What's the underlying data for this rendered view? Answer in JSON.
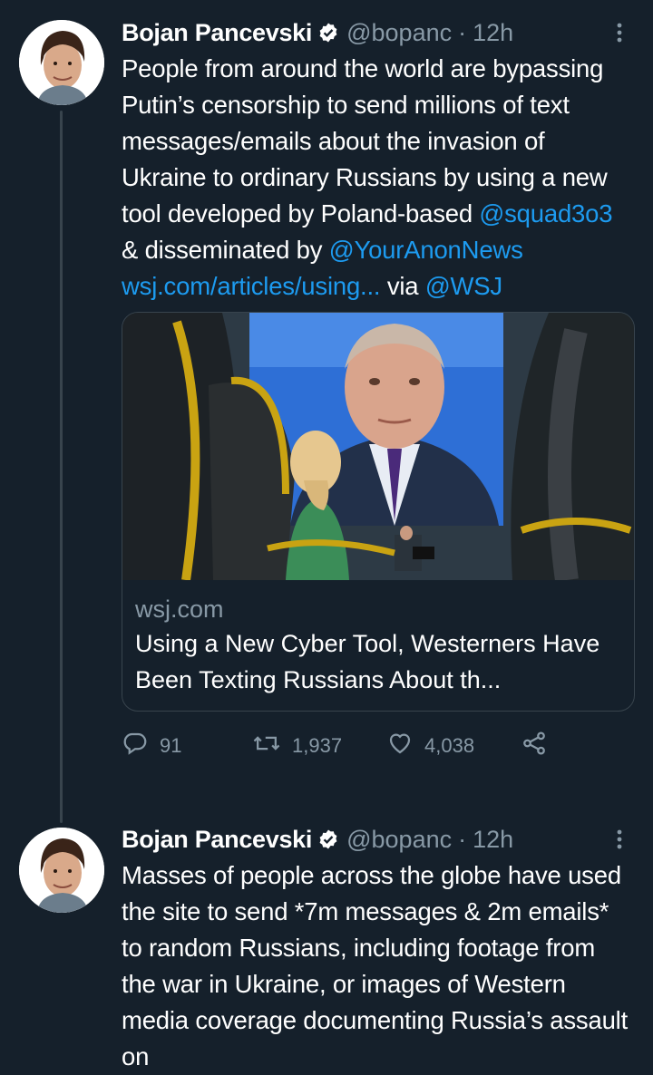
{
  "tweets": [
    {
      "author_name": "Bojan Pancevski",
      "handle": "@bopanc",
      "separator": "·",
      "time": "12h",
      "text_parts": {
        "p1": "People from around the world are bypassing Putin’s censorship to send millions of text messages/emails about the invasion of Ukraine to ordinary Russians by using a new tool developed by Poland-based ",
        "mention1": "@squad3o3",
        "p2": " & disseminated by ",
        "mention2": "@YourAnonNews",
        "link": "wsj.com/articles/using...",
        "p3": " via ",
        "mention3": "@WSJ"
      },
      "card": {
        "domain": "wsj.com",
        "title": "Using a New Cyber Tool, Westerners Have Been Texting Russians About th..."
      },
      "actions": {
        "replies": "91",
        "retweets": "1,937",
        "likes": "4,038"
      }
    },
    {
      "author_name": "Bojan Pancevski",
      "handle": "@bopanc",
      "separator": "·",
      "time": "12h",
      "text": "Masses of people across the globe have used the site to send *7m messages & 2m emails* to random Russians, including footage from the war in Ukraine, or images of Western media coverage documenting Russia’s assault on"
    }
  ],
  "icons": {
    "verified": "verified-badge-icon",
    "more": "more-options-icon",
    "reply": "reply-icon",
    "retweet": "retweet-icon",
    "like": "like-icon",
    "share": "share-icon"
  },
  "colors": {
    "background": "#15202b",
    "link": "#1d9bf0",
    "secondary_text": "#8899a6",
    "border": "#38444d"
  }
}
